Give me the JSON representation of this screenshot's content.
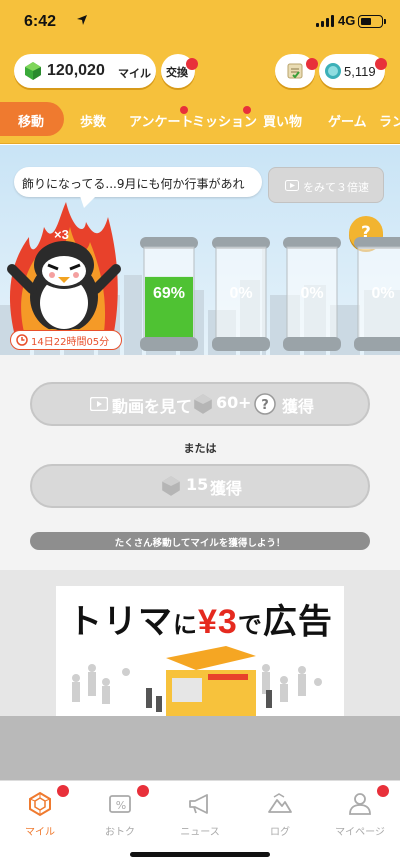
{
  "status_bar": {
    "time": "6:42",
    "network": "4G",
    "battery_level": 0.55
  },
  "header": {
    "miles_value": "120,020",
    "miles_unit": "マイル",
    "exchange_label": "交換",
    "coin_value": "5,119"
  },
  "tabs": [
    {
      "label": "移動",
      "active": true
    },
    {
      "label": "歩数"
    },
    {
      "label": "アンケート",
      "badge": true
    },
    {
      "label": "ミッション",
      "badge": true
    },
    {
      "label": "買い物"
    },
    {
      "label": "ゲーム"
    },
    {
      "label": "ラン"
    }
  ],
  "hero": {
    "message": "飾りになってる...9月にも何か行事があれ",
    "triple_button": "をみて３倍速",
    "multiplier": "×3",
    "timer": "14日22時間05分",
    "help": "?",
    "tanks": [
      {
        "percent_label": "69%",
        "fill": 0.69
      },
      {
        "percent_label": "0%",
        "fill": 0
      },
      {
        "percent_label": "0%",
        "fill": 0
      },
      {
        "percent_label": "0%",
        "fill": 0
      }
    ]
  },
  "actions": {
    "video_button": {
      "prefix": "動画を見て",
      "amount": "60",
      "plus": "+",
      "suffix": "獲得"
    },
    "or_text": "または",
    "plain_button": {
      "amount": "15",
      "suffix": "獲得"
    },
    "hint": "たくさん移動してマイルを獲得しよう！"
  },
  "ad": {
    "part1": "トリマ",
    "part2": "に",
    "part3": "¥3",
    "part4": "で",
    "part5": "広告"
  },
  "bottom_nav": [
    {
      "label": "マイル",
      "icon": "gem-outline-icon",
      "active": true,
      "badge": true
    },
    {
      "label": "おトク",
      "icon": "percent-ticket-icon",
      "badge": true
    },
    {
      "label": "ニュース",
      "icon": "megaphone-icon"
    },
    {
      "label": "ログ",
      "icon": "mountain-icon"
    },
    {
      "label": "マイページ",
      "icon": "person-icon",
      "badge": true
    }
  ],
  "colors": {
    "header": "#f6c13c",
    "accent": "#ef7a2f",
    "badge": "#e8303a",
    "tank_fill": "#4fc233"
  }
}
